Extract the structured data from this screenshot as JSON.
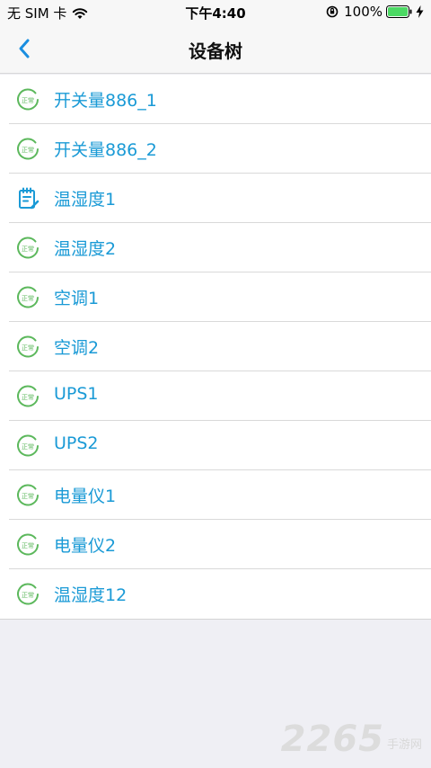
{
  "status_bar": {
    "carrier": "无 SIM 卡",
    "time": "下午4:40",
    "battery_percent": "100%"
  },
  "nav": {
    "title": "设备树"
  },
  "status_icon_text": "正常",
  "devices": [
    {
      "label": "开关量886_1",
      "icon": "status-normal-icon"
    },
    {
      "label": "开关量886_2",
      "icon": "status-normal-icon"
    },
    {
      "label": "温湿度1",
      "icon": "notepad-edit-icon"
    },
    {
      "label": "温湿度2",
      "icon": "status-normal-icon"
    },
    {
      "label": "空调1",
      "icon": "status-normal-icon"
    },
    {
      "label": "空调2",
      "icon": "status-normal-icon"
    },
    {
      "label": "UPS1",
      "icon": "status-normal-icon"
    },
    {
      "label": "UPS2",
      "icon": "status-normal-icon"
    },
    {
      "label": "电量仪1",
      "icon": "status-normal-icon"
    },
    {
      "label": "电量仪2",
      "icon": "status-normal-icon"
    },
    {
      "label": "温湿度12",
      "icon": "status-normal-icon"
    }
  ],
  "watermark": {
    "number": "2265",
    "text": "手游网"
  },
  "colors": {
    "accent": "#1a9ad6",
    "status_green": "#5cb85c",
    "battery_green": "#4cd964"
  }
}
